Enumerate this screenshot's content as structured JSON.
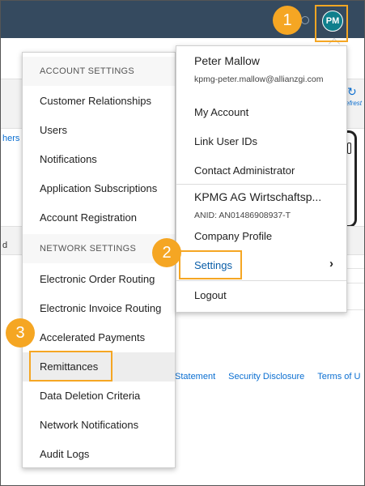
{
  "header": {
    "avatar_initials": "PM",
    "accent_color": "#f5a623",
    "avatar_color": "#0f7f8c",
    "bar_color": "#354a5f"
  },
  "callouts": [
    "1",
    "2",
    "3"
  ],
  "background": {
    "partial_left": "hers",
    "partial_refresh": "efrest",
    "partial_row": "d",
    "footer_links": [
      "Statement",
      "Security Disclosure",
      "Terms of U"
    ]
  },
  "account_menu": {
    "section_account": "ACCOUNT SETTINGS",
    "account_items": [
      "Customer Relationships",
      "Users",
      "Notifications",
      "Application Subscriptions",
      "Account Registration"
    ],
    "section_network": "NETWORK SETTINGS",
    "network_items": [
      "Electronic Order Routing",
      "Electronic Invoice Routing",
      "Accelerated Payments",
      "Remittances",
      "Data Deletion Criteria",
      "Network Notifications",
      "Audit Logs"
    ]
  },
  "user_menu": {
    "name": "Peter Mallow",
    "email": "kpmg-peter.mallow@allianzgi.com",
    "items": [
      "My Account",
      "Link User IDs",
      "Contact Administrator"
    ],
    "company": "KPMG AG Wirtschaftsp...",
    "anid": "ANID: AN01486908937-T",
    "company_profile": "Company Profile",
    "settings": "Settings",
    "logout": "Logout"
  }
}
